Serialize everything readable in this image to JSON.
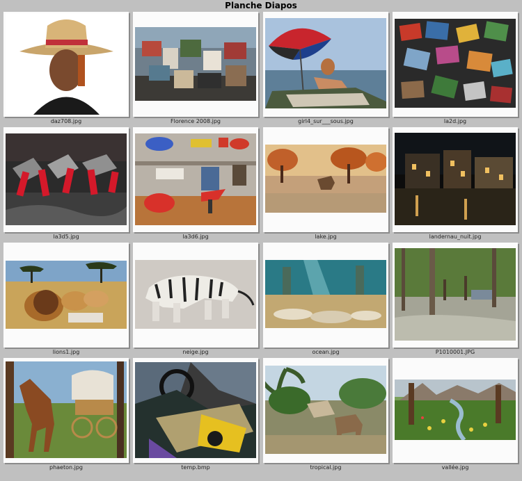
{
  "title": "Planche Diapos",
  "items": [
    {
      "filename": "daz708.jpg",
      "subject": "woman-with-straw-hat"
    },
    {
      "filename": "Florence 2008.jpg",
      "subject": "photo-collage"
    },
    {
      "filename": "girl4_sur___sous.jpg",
      "subject": "girl-with-umbrella-by-sea"
    },
    {
      "filename": "la2d.jpg",
      "subject": "scattered-photos-collage"
    },
    {
      "filename": "la3d5.jpg",
      "subject": "red-black-3d-shapes"
    },
    {
      "filename": "la3d6.jpg",
      "subject": "toy-room"
    },
    {
      "filename": "lake.jpg",
      "subject": "autumn-lake-with-horse"
    },
    {
      "filename": "landernau_nuit.jpg",
      "subject": "town-at-night"
    },
    {
      "filename": "lions1.jpg",
      "subject": "lions-in-savanna"
    },
    {
      "filename": "neige.jpg",
      "subject": "white-tiger-in-snow"
    },
    {
      "filename": "ocean.jpg",
      "subject": "underwater-scene"
    },
    {
      "filename": "P1010001.JPG",
      "subject": "forest-clearing"
    },
    {
      "filename": "phaeton.jpg",
      "subject": "horse-and-carriage"
    },
    {
      "filename": "temp.bmp",
      "subject": "abstract-guitar-composition"
    },
    {
      "filename": "tropical.jpg",
      "subject": "tropical-donkey"
    },
    {
      "filename": "vallée.jpg",
      "subject": "flowery-valley"
    }
  ]
}
